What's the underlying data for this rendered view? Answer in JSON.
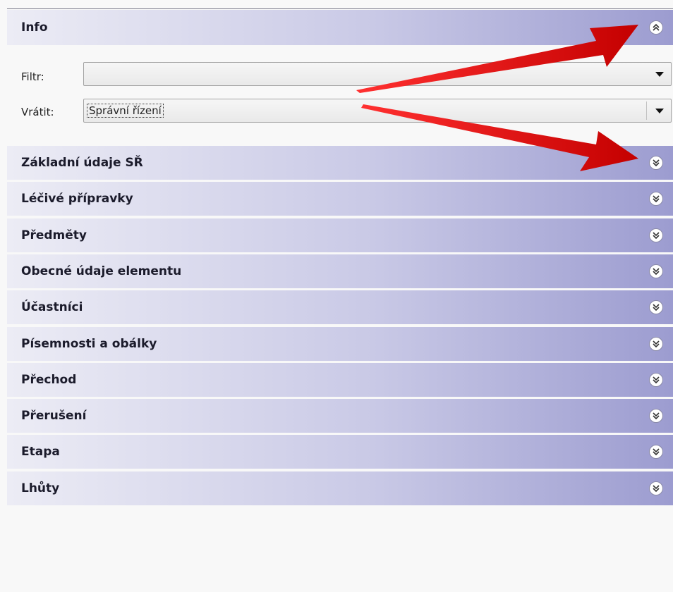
{
  "info": {
    "title": "Info",
    "filter_label": "Filtr:",
    "filter_value": "",
    "return_label": "Vrátit:",
    "return_value": "Správní řízení"
  },
  "sections": [
    {
      "title": "Základní údaje SŘ"
    },
    {
      "title": "Léčivé přípravky"
    },
    {
      "title": "Předměty"
    },
    {
      "title": "Obecné údaje elementu"
    },
    {
      "title": "Účastníci"
    },
    {
      "title": "Písemnosti a obálky"
    },
    {
      "title": "Přechod"
    },
    {
      "title": "Přerušení"
    },
    {
      "title": "Etapa"
    },
    {
      "title": "Lhůty"
    }
  ],
  "colors": {
    "header_gradient_start": "#ececf5",
    "header_gradient_end": "#9c9cd0",
    "annotation_arrow": "#e01010"
  },
  "icons": {
    "expanded": "chevron-up-double-icon",
    "collapsed": "chevron-down-double-icon"
  }
}
